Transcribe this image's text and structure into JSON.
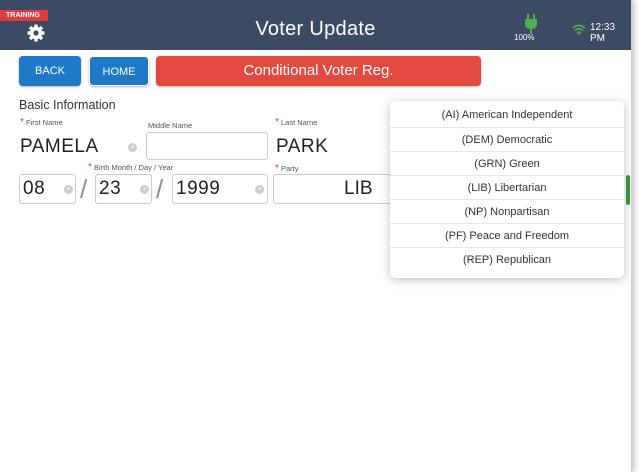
{
  "header": {
    "badge": "TRAINING",
    "title": "Voter Update",
    "battery": "100%",
    "time": "12:33 PM",
    "gear_icon": "gear-icon",
    "battery_icon": "battery-charging-icon",
    "wifi_icon": "wifi-icon"
  },
  "nav": {
    "back": "BACK",
    "home": "HOME",
    "banner": "Conditional Voter Reg."
  },
  "form": {
    "section_title": "Basic Information",
    "first_name": {
      "label": "First Name",
      "value": "PAMELA",
      "required": true
    },
    "middle_name": {
      "label": "Middle Name",
      "value": ""
    },
    "last_name": {
      "label": "Last Name",
      "value": "PARK",
      "required": true
    },
    "birth_label": "Birth Month / Day / Year",
    "birth_month": "08",
    "birth_day": "23",
    "birth_year": "1999",
    "party": {
      "label": "Party",
      "value": "LIB"
    }
  },
  "dropdown": {
    "options": [
      "(AI) American Independent",
      "(DEM) Democratic",
      "(GRN) Green",
      "(LIB) Libertarian",
      "(NP) Nonpartisan",
      "(PF) Peace and Freedom",
      "(REP) Republican"
    ]
  },
  "colors": {
    "header": "#3c4a63",
    "button": "#1e7ac8",
    "banner": "#e24a3f",
    "accent_green": "#3b9a3b",
    "required": "#e23b3b"
  }
}
